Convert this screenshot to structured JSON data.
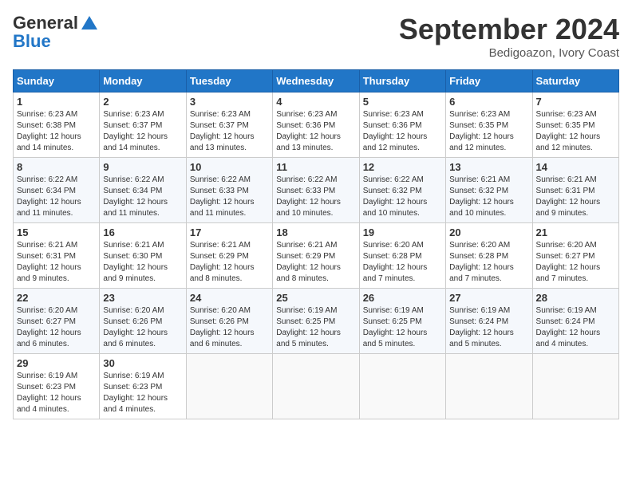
{
  "header": {
    "logo_line1": "General",
    "logo_line2": "Blue",
    "month": "September 2024",
    "location": "Bedigoazon, Ivory Coast"
  },
  "weekdays": [
    "Sunday",
    "Monday",
    "Tuesday",
    "Wednesday",
    "Thursday",
    "Friday",
    "Saturday"
  ],
  "weeks": [
    [
      {
        "day": "1",
        "info": "Sunrise: 6:23 AM\nSunset: 6:38 PM\nDaylight: 12 hours\nand 14 minutes."
      },
      {
        "day": "2",
        "info": "Sunrise: 6:23 AM\nSunset: 6:37 PM\nDaylight: 12 hours\nand 14 minutes."
      },
      {
        "day": "3",
        "info": "Sunrise: 6:23 AM\nSunset: 6:37 PM\nDaylight: 12 hours\nand 13 minutes."
      },
      {
        "day": "4",
        "info": "Sunrise: 6:23 AM\nSunset: 6:36 PM\nDaylight: 12 hours\nand 13 minutes."
      },
      {
        "day": "5",
        "info": "Sunrise: 6:23 AM\nSunset: 6:36 PM\nDaylight: 12 hours\nand 12 minutes."
      },
      {
        "day": "6",
        "info": "Sunrise: 6:23 AM\nSunset: 6:35 PM\nDaylight: 12 hours\nand 12 minutes."
      },
      {
        "day": "7",
        "info": "Sunrise: 6:23 AM\nSunset: 6:35 PM\nDaylight: 12 hours\nand 12 minutes."
      }
    ],
    [
      {
        "day": "8",
        "info": "Sunrise: 6:22 AM\nSunset: 6:34 PM\nDaylight: 12 hours\nand 11 minutes."
      },
      {
        "day": "9",
        "info": "Sunrise: 6:22 AM\nSunset: 6:34 PM\nDaylight: 12 hours\nand 11 minutes."
      },
      {
        "day": "10",
        "info": "Sunrise: 6:22 AM\nSunset: 6:33 PM\nDaylight: 12 hours\nand 11 minutes."
      },
      {
        "day": "11",
        "info": "Sunrise: 6:22 AM\nSunset: 6:33 PM\nDaylight: 12 hours\nand 10 minutes."
      },
      {
        "day": "12",
        "info": "Sunrise: 6:22 AM\nSunset: 6:32 PM\nDaylight: 12 hours\nand 10 minutes."
      },
      {
        "day": "13",
        "info": "Sunrise: 6:21 AM\nSunset: 6:32 PM\nDaylight: 12 hours\nand 10 minutes."
      },
      {
        "day": "14",
        "info": "Sunrise: 6:21 AM\nSunset: 6:31 PM\nDaylight: 12 hours\nand 9 minutes."
      }
    ],
    [
      {
        "day": "15",
        "info": "Sunrise: 6:21 AM\nSunset: 6:31 PM\nDaylight: 12 hours\nand 9 minutes."
      },
      {
        "day": "16",
        "info": "Sunrise: 6:21 AM\nSunset: 6:30 PM\nDaylight: 12 hours\nand 9 minutes."
      },
      {
        "day": "17",
        "info": "Sunrise: 6:21 AM\nSunset: 6:29 PM\nDaylight: 12 hours\nand 8 minutes."
      },
      {
        "day": "18",
        "info": "Sunrise: 6:21 AM\nSunset: 6:29 PM\nDaylight: 12 hours\nand 8 minutes."
      },
      {
        "day": "19",
        "info": "Sunrise: 6:20 AM\nSunset: 6:28 PM\nDaylight: 12 hours\nand 7 minutes."
      },
      {
        "day": "20",
        "info": "Sunrise: 6:20 AM\nSunset: 6:28 PM\nDaylight: 12 hours\nand 7 minutes."
      },
      {
        "day": "21",
        "info": "Sunrise: 6:20 AM\nSunset: 6:27 PM\nDaylight: 12 hours\nand 7 minutes."
      }
    ],
    [
      {
        "day": "22",
        "info": "Sunrise: 6:20 AM\nSunset: 6:27 PM\nDaylight: 12 hours\nand 6 minutes."
      },
      {
        "day": "23",
        "info": "Sunrise: 6:20 AM\nSunset: 6:26 PM\nDaylight: 12 hours\nand 6 minutes."
      },
      {
        "day": "24",
        "info": "Sunrise: 6:20 AM\nSunset: 6:26 PM\nDaylight: 12 hours\nand 6 minutes."
      },
      {
        "day": "25",
        "info": "Sunrise: 6:19 AM\nSunset: 6:25 PM\nDaylight: 12 hours\nand 5 minutes."
      },
      {
        "day": "26",
        "info": "Sunrise: 6:19 AM\nSunset: 6:25 PM\nDaylight: 12 hours\nand 5 minutes."
      },
      {
        "day": "27",
        "info": "Sunrise: 6:19 AM\nSunset: 6:24 PM\nDaylight: 12 hours\nand 5 minutes."
      },
      {
        "day": "28",
        "info": "Sunrise: 6:19 AM\nSunset: 6:24 PM\nDaylight: 12 hours\nand 4 minutes."
      }
    ],
    [
      {
        "day": "29",
        "info": "Sunrise: 6:19 AM\nSunset: 6:23 PM\nDaylight: 12 hours\nand 4 minutes."
      },
      {
        "day": "30",
        "info": "Sunrise: 6:19 AM\nSunset: 6:23 PM\nDaylight: 12 hours\nand 4 minutes."
      },
      {
        "day": "",
        "info": ""
      },
      {
        "day": "",
        "info": ""
      },
      {
        "day": "",
        "info": ""
      },
      {
        "day": "",
        "info": ""
      },
      {
        "day": "",
        "info": ""
      }
    ]
  ]
}
